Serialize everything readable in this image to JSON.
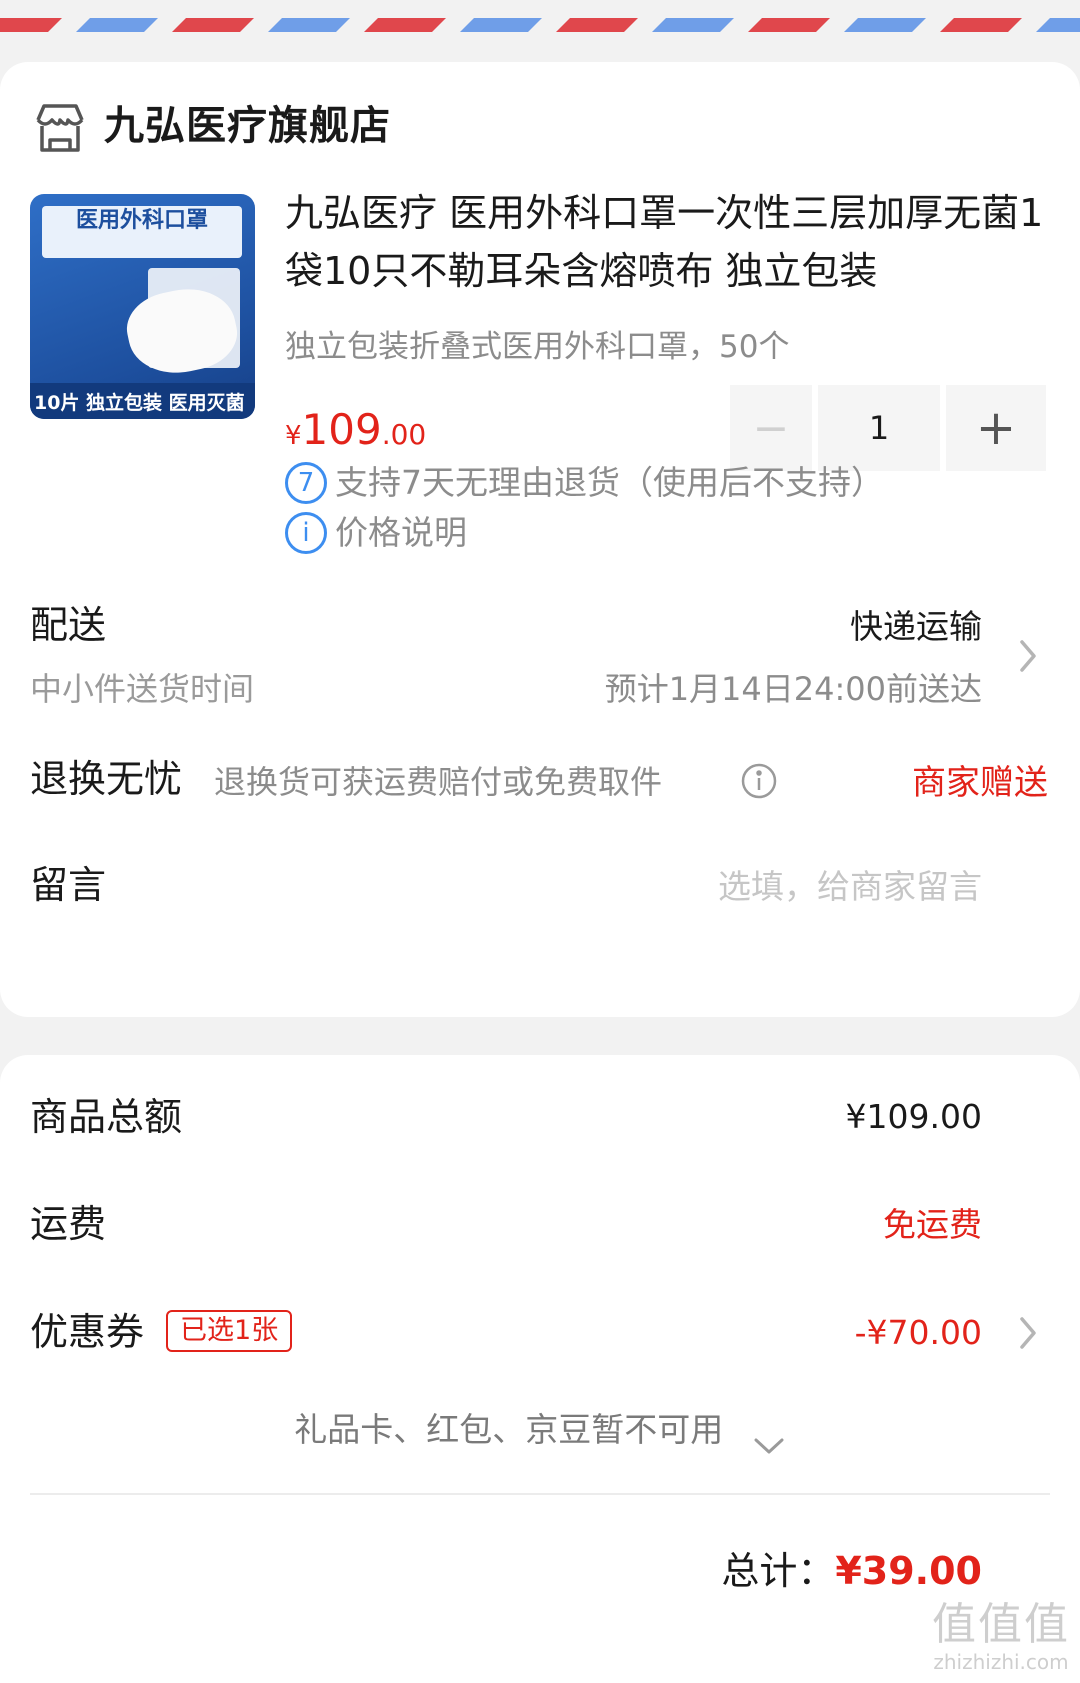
{
  "store": {
    "name": "九弘医疗旗舰店",
    "icon": "store-icon"
  },
  "product": {
    "image_texts": {
      "title": "医用外科口罩",
      "footer": "10片 独立包装 医用灭菌"
    },
    "title": "九弘医疗 医用外科口罩一次性三层加厚无菌1袋10只不勒耳朵含熔喷布 独立包装",
    "spec": "独立包装折叠式医用外科口罩，50个",
    "price": {
      "currency": "¥",
      "integer": "109",
      "decimal": ".00"
    },
    "quantity": {
      "minus": "−",
      "value": "1",
      "plus": "+"
    },
    "services": [
      {
        "badge": "7",
        "text": "支持7天无理由退货（使用后不支持）"
      },
      {
        "badge": "i",
        "text": "价格说明"
      }
    ]
  },
  "delivery": {
    "label": "配送",
    "method": "快递运输",
    "sub_label": "中小件送货时间",
    "eta": "预计1月14日24:00前送达"
  },
  "returns": {
    "label": "退换无忧",
    "desc": "退换货可获运费赔付或免费取件",
    "value": "商家赠送"
  },
  "message": {
    "label": "留言",
    "placeholder": "选填，给商家留言"
  },
  "summary": {
    "goods_total_label": "商品总额",
    "goods_total_value": "¥109.00",
    "shipping_label": "运费",
    "shipping_value": "免运费",
    "coupon_label": "优惠券",
    "coupon_tag": "已选1张",
    "coupon_value": "-¥70.00",
    "unavailable_note": "礼品卡、红包、京豆暂不可用",
    "total_label": "总计：",
    "total_value": "¥39.00"
  },
  "watermark": {
    "big": "值值值",
    "small": "zhizhizhi.com"
  },
  "colors": {
    "accent_red": "#e2231a",
    "info_blue": "#3d8ef0",
    "stripe_red": "#e0474c",
    "stripe_blue": "#6f9ee8"
  }
}
